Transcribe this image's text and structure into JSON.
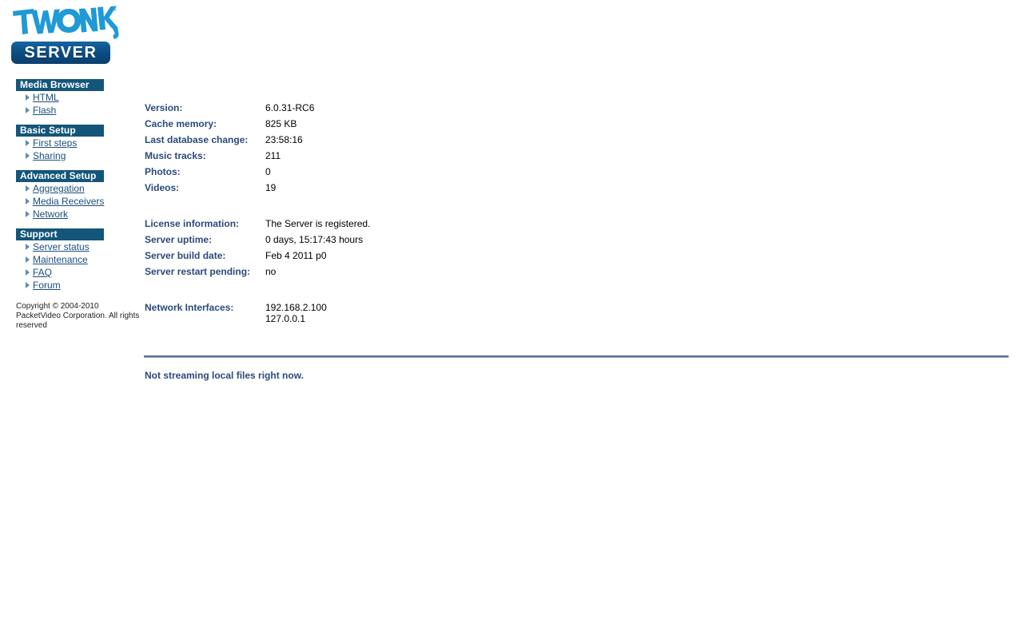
{
  "logo": {
    "wordmark": "TWONKY",
    "trademark": "™",
    "product": "SERVER",
    "wordmark_color": "#1f9ad6",
    "bar_color": "#0d4d82"
  },
  "sidebar": {
    "sections": [
      {
        "title": "Media Browser",
        "items": [
          {
            "label": "HTML",
            "icon": "arrow-right-icon"
          },
          {
            "label": "Flash",
            "icon": "arrow-right-icon"
          }
        ]
      },
      {
        "title": "Basic Setup",
        "items": [
          {
            "label": "First steps",
            "icon": "arrow-right-icon"
          },
          {
            "label": "Sharing",
            "icon": "arrow-right-icon"
          }
        ]
      },
      {
        "title": "Advanced Setup",
        "items": [
          {
            "label": "Aggregation",
            "icon": "arrow-right-icon"
          },
          {
            "label": "Media Receivers",
            "icon": "arrow-right-icon"
          },
          {
            "label": "Network",
            "icon": "arrow-right-icon"
          }
        ]
      },
      {
        "title": "Support",
        "items": [
          {
            "label": "Server status",
            "icon": "arrow-right-icon"
          },
          {
            "label": "Maintenance",
            "icon": "arrow-right-icon"
          },
          {
            "label": "FAQ",
            "icon": "arrow-right-icon"
          },
          {
            "label": "Forum",
            "icon": "arrow-right-icon"
          }
        ]
      }
    ],
    "copyright": "Copyright © 2004-2010\nPacketVideo Corporation.\nAll rights reserved",
    "header_bg": "#14567a",
    "link_color": "#1b4f7e",
    "arrow_color": "#5f89b3"
  },
  "main": {
    "groups": [
      {
        "rows": [
          {
            "label": "Version:",
            "value": "6.0.31-RC6"
          },
          {
            "label": "Cache memory:",
            "value": "825 KB"
          },
          {
            "label": "Last database change:",
            "value": "23:58:16"
          },
          {
            "label": "Music tracks:",
            "value": "211"
          },
          {
            "label": "Photos:",
            "value": "0"
          },
          {
            "label": "Videos:",
            "value": "19"
          }
        ]
      },
      {
        "rows": [
          {
            "label": "License information:",
            "value": "The Server is registered."
          },
          {
            "label": "Server uptime:",
            "value": "0 days, 15:17:43 hours"
          },
          {
            "label": "Server build date:",
            "value": "Feb 4 2011 p0"
          },
          {
            "label": "Server restart pending:",
            "value": "no"
          }
        ]
      },
      {
        "rows": [
          {
            "label": "Network Interfaces:",
            "value": "192.168.2.100\n127.0.0.1"
          }
        ]
      }
    ],
    "label_color": "#2a4a7c",
    "divider_color": "#5a6e9e",
    "stream_status": "Not streaming local files right now."
  }
}
